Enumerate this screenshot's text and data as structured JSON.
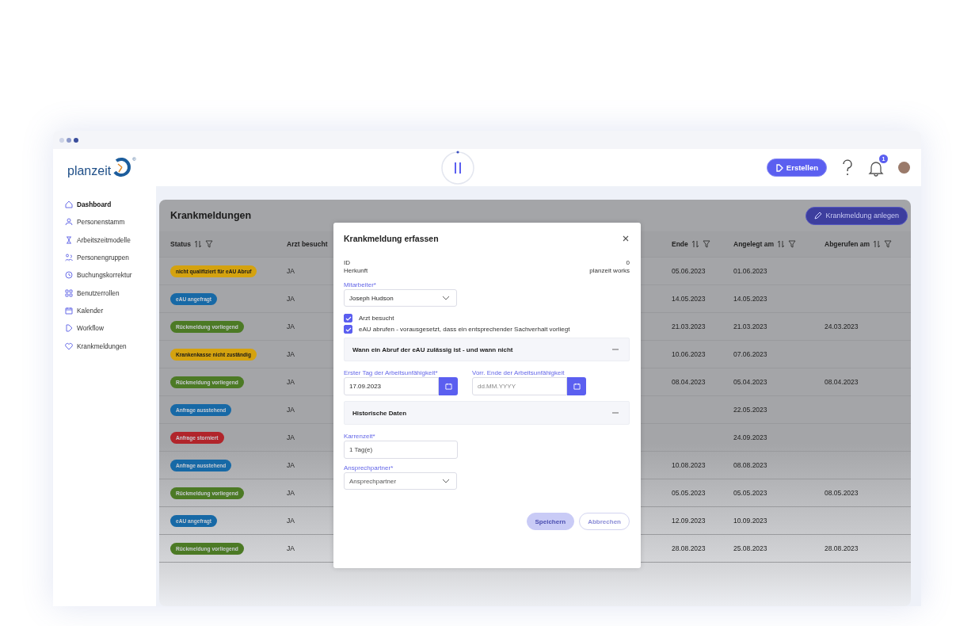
{
  "logo": {
    "text": "planzeit",
    "registered": "®"
  },
  "header": {
    "create_button": "Erstellen",
    "notification_count": "1"
  },
  "sidebar": {
    "items": [
      {
        "label": "Dashboard",
        "selected": true
      },
      {
        "label": "Personenstamm",
        "selected": false
      },
      {
        "label": "Arbeitszeitmodelle",
        "selected": false
      },
      {
        "label": "Personengruppen",
        "selected": false
      },
      {
        "label": "Buchungskorrektur",
        "selected": false
      },
      {
        "label": "Benutzerrollen",
        "selected": false
      },
      {
        "label": "Kalender",
        "selected": false
      },
      {
        "label": "Workflow",
        "selected": false
      },
      {
        "label": "Krankmeldungen",
        "selected": false
      }
    ]
  },
  "page": {
    "title": "Krankmeldungen",
    "add_button": "Krankmeldung anlegen"
  },
  "table": {
    "columns": [
      {
        "label": "Status",
        "sortable": true
      },
      {
        "label": "Arzt besucht",
        "sortable": false
      },
      {
        "label": "Ende",
        "sortable": true
      },
      {
        "label": "Angelegt am",
        "sortable": true
      },
      {
        "label": "Abgerufen am",
        "sortable": true
      }
    ],
    "rows": [
      {
        "status": "nicht qualifiziert für eAU Abruf",
        "color": "#d4a20f",
        "arzt": "JA",
        "ende": "05.06.2023",
        "angelegt": "01.06.2023",
        "abgerufen": ""
      },
      {
        "status": "eAU angefragt",
        "color": "#1769a6",
        "arzt": "JA",
        "ende": "14.05.2023",
        "angelegt": "14.05.2023",
        "abgerufen": ""
      },
      {
        "status": "Rückmeldung vorliegend",
        "color": "#4c7a25",
        "arzt": "JA",
        "ende": "21.03.2023",
        "angelegt": "21.03.2023",
        "abgerufen": "24.03.2023"
      },
      {
        "status": "Krankenkasse nicht zuständig",
        "color": "#d4a20f",
        "arzt": "JA",
        "ende": "10.06.2023",
        "angelegt": "07.06.2023",
        "abgerufen": ""
      },
      {
        "status": "Rückmeldung vorliegend",
        "color": "#4c7a25",
        "arzt": "JA",
        "ende": "08.04.2023",
        "angelegt": "05.04.2023",
        "abgerufen": "08.04.2023"
      },
      {
        "status": "Anfrage ausstehend",
        "color": "#1769a6",
        "arzt": "JA",
        "ende": "",
        "angelegt": "22.05.2023",
        "abgerufen": ""
      },
      {
        "status": "Anfrage storniert",
        "color": "#b1252b",
        "arzt": "JA",
        "ende": "",
        "angelegt": "24.09.2023",
        "abgerufen": ""
      },
      {
        "status": "Anfrage ausstehend",
        "color": "#1769a6",
        "arzt": "JA",
        "ende": "10.08.2023",
        "angelegt": "08.08.2023",
        "abgerufen": ""
      },
      {
        "status": "Rückmeldung vorliegend",
        "color": "#4c7a25",
        "arzt": "JA",
        "ende": "05.05.2023",
        "angelegt": "05.05.2023",
        "abgerufen": "08.05.2023"
      },
      {
        "status": "eAU angefragt",
        "color": "#1769a6",
        "arzt": "JA",
        "ende": "12.09.2023",
        "angelegt": "10.09.2023",
        "abgerufen": ""
      },
      {
        "status": "Rückmeldung vorliegend",
        "color": "#4c7a25",
        "arzt": "JA",
        "ende": "28.08.2023",
        "angelegt": "25.08.2023",
        "abgerufen": "28.08.2023"
      }
    ]
  },
  "dialog": {
    "title": "Krankmeldung erfassen",
    "info": [
      {
        "label": "ID",
        "value": "0"
      },
      {
        "label": "Herkunft",
        "value": "planzeit works"
      }
    ],
    "employee": {
      "label": "Mitarbeiter*",
      "value": "Joseph Hudson"
    },
    "checkboxes": [
      {
        "label": "Arzt besucht",
        "checked": true
      },
      {
        "label": "eAU abrufen - vorausgesetzt, dass ein entsprechender Sachverhalt vorliegt",
        "checked": true
      }
    ],
    "section_1": {
      "title": "Wann ein Abruf der eAU zulässig ist - und wann nicht",
      "expanded": true
    },
    "start_date": {
      "label": "Erster Tag der Arbeitsunfähigkeit*",
      "value": "17.09.2023"
    },
    "end_date": {
      "label": "Vorr. Ende der Arbeitsunfähigkeit",
      "placeholder": "dd.MM.YYYY"
    },
    "section_2": {
      "title": "Historische Daten",
      "expanded": true
    },
    "waiting_period": {
      "label": "Karrenzeit*",
      "value": "1 Tag(e)"
    },
    "contact": {
      "label": "Ansprechpartner*",
      "placeholder": "Ansprechpartner"
    },
    "buttons": [
      {
        "label": "Speichern",
        "kind": "primary",
        "disabled": true
      },
      {
        "label": "Abbrechen",
        "kind": "secondary",
        "disabled": true
      }
    ]
  }
}
